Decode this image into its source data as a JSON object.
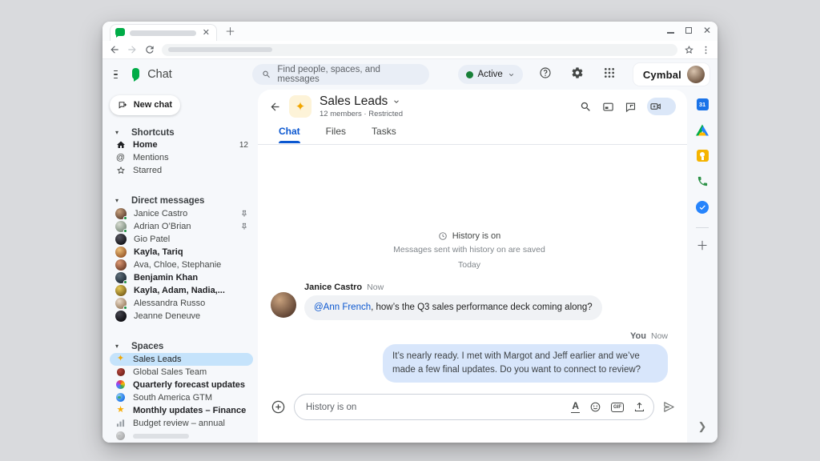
{
  "colors": {
    "accent_blue": "#0b57d0",
    "active_green": "#188038",
    "brand_green": "#00ac47",
    "selected_item_bg": "#c5e3fb",
    "bubble_gray": "#f0f2f5",
    "bubble_blue": "#d8e6fb"
  },
  "app_header": {
    "product": "Chat",
    "search_placeholder": "Find people, spaces, and messages",
    "status": "Active",
    "org": "Cymbal"
  },
  "sidebar": {
    "new_chat": "New chat",
    "shortcuts": {
      "title": "Shortcuts",
      "items": [
        {
          "label": "Home",
          "badge": "12"
        },
        {
          "label": "Mentions"
        },
        {
          "label": "Starred"
        }
      ]
    },
    "dm": {
      "title": "Direct messages",
      "items": [
        {
          "name": "Janice Castro"
        },
        {
          "name": "Adrian O’Brian"
        },
        {
          "name": "Gio Patel"
        },
        {
          "name": "Kayla, Tariq"
        },
        {
          "name": "Ava, Chloe, Stephanie"
        },
        {
          "name": "Benjamin Khan"
        },
        {
          "name": "Kayla, Adam, Nadia,..."
        },
        {
          "name": "Alessandra Russo"
        },
        {
          "name": "Jeanne Deneuve"
        }
      ]
    },
    "spaces": {
      "title": "Spaces",
      "items": [
        {
          "name": "Sales Leads"
        },
        {
          "name": "Global Sales Team"
        },
        {
          "name": "Quarterly forecast updates"
        },
        {
          "name": "South America GTM"
        },
        {
          "name": "Monthly updates – Finance"
        },
        {
          "name": "Budget review – annual"
        }
      ]
    }
  },
  "chat": {
    "title": "Sales Leads",
    "subtitle": "12 members · Restricted",
    "tabs": [
      "Chat",
      "Files",
      "Tasks"
    ],
    "history": {
      "title": "History is on",
      "subtitle": "Messages sent with history on are saved"
    },
    "day": "Today",
    "messages": [
      {
        "sender": "Janice Castro",
        "time": "Now",
        "mention": "@Ann French",
        "text": ", how’s the Q3 sales performance deck coming along?"
      },
      {
        "sender": "You",
        "time": "Now",
        "text": "It’s nearly ready. I met with Margot and Jeff earlier and we’ve made a few final updates. Do you want to connect to review?"
      }
    ],
    "compose": {
      "placeholder": "History is on",
      "gif_label": "GIF"
    }
  },
  "rail": {
    "calendar_label": "31"
  }
}
